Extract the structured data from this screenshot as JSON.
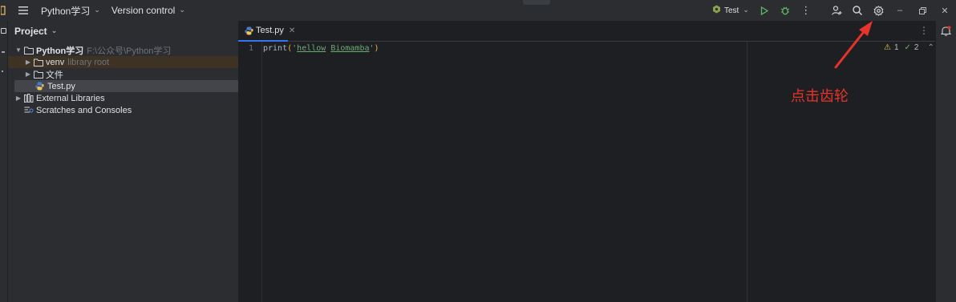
{
  "titlebar": {
    "project_name": "Python学习",
    "vcs": "Version control",
    "run_config": "Test"
  },
  "project_panel": {
    "title": "Project",
    "tree": [
      {
        "label": "Python学习",
        "hint": "F:\\公众号\\Python学习",
        "icon": "folder-icon"
      },
      {
        "label": "venv",
        "hint": "library root",
        "icon": "folder-icon"
      },
      {
        "label": "文件",
        "hint": "",
        "icon": "folder-icon"
      },
      {
        "label": "Test.py",
        "hint": "",
        "icon": "python-file-icon"
      },
      {
        "label": "External Libraries",
        "hint": "",
        "icon": "library-icon"
      },
      {
        "label": "Scratches and Consoles",
        "hint": "",
        "icon": "scratches-icon"
      }
    ]
  },
  "editor": {
    "tab": "Test.py",
    "line_number": "1",
    "code": {
      "func": "print",
      "open_paren": "(",
      "open_quote": "'",
      "word1": "hellow",
      "space": " ",
      "word2": "Biomamba",
      "close_quote": "'",
      "close_paren": ")"
    },
    "warnings": "1",
    "checks": "2"
  },
  "annotation": {
    "text": "点击齿轮",
    "color": "#e8332a"
  },
  "colors": {
    "accent": "#3574f0",
    "run": "#5fb865",
    "warning": "#f2c55c"
  }
}
